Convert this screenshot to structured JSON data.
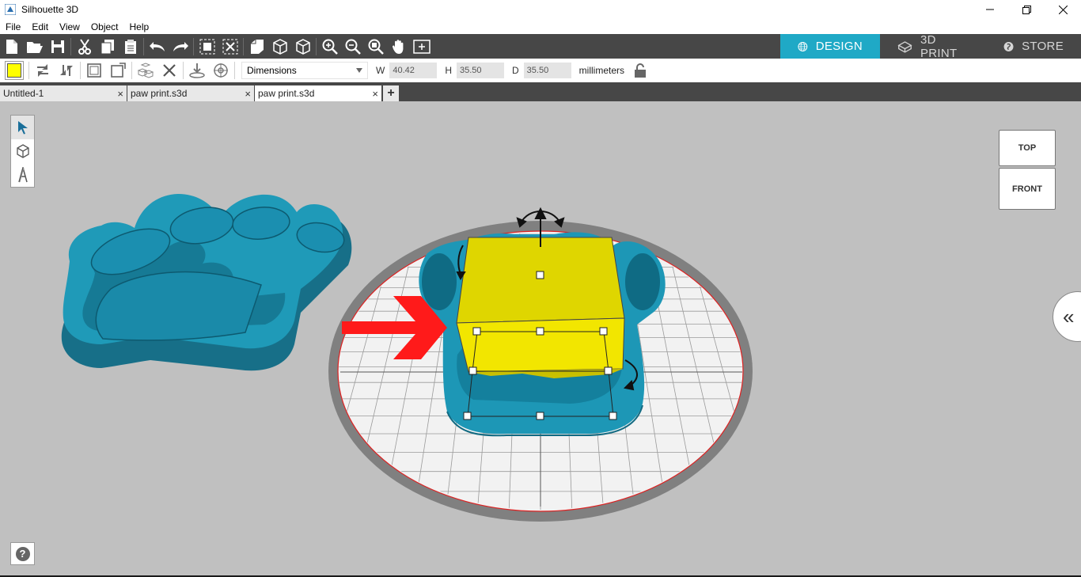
{
  "window": {
    "title": "Silhouette 3D",
    "minimize_icon": "minimize-icon",
    "maximize_icon": "restore-icon",
    "close_icon": "close-icon"
  },
  "menu": [
    "File",
    "Edit",
    "View",
    "Object",
    "Help"
  ],
  "toolbar": {
    "icons": [
      "new-file-icon",
      "open-folder-icon",
      "save-icon",
      "cut-icon",
      "copy-icon",
      "paste-icon",
      "undo-icon",
      "redo-icon",
      "group-icon",
      "ungroup-icon",
      "boolean-icon",
      "cube-icon",
      "cube-alt-icon",
      "zoom-in-icon",
      "zoom-out-icon",
      "zoom-fit-icon",
      "pan-hand-icon",
      "frame-icon"
    ],
    "modes": [
      {
        "label": "DESIGN",
        "icon": "globe-icon",
        "active": true
      },
      {
        "label": "3D PRINT",
        "icon": "printer-icon",
        "active": false
      },
      {
        "label": "STORE",
        "icon": "store-icon",
        "active": false
      }
    ]
  },
  "properties": {
    "fill_color": "#ffff00",
    "dropdown_selected": "Dimensions",
    "width_label": "W",
    "width_value": "40.42",
    "height_label": "H",
    "height_value": "35.50",
    "depth_label": "D",
    "depth_value": "35.50",
    "unit": "millimeters"
  },
  "tabs": [
    {
      "label": "Untitled-1",
      "active": false
    },
    {
      "label": "paw print.s3d",
      "active": false
    },
    {
      "label": "paw print.s3d",
      "active": true
    }
  ],
  "tab_close": "×",
  "tab_add": "+",
  "view_cube": {
    "top": "TOP",
    "front": "FRONT"
  },
  "side_toggle": "«",
  "help": "?",
  "colors": {
    "accent": "#1fa9c6",
    "model": "#1b8fb0",
    "selection": "#e8e000",
    "arrow": "#ff1a1a"
  }
}
